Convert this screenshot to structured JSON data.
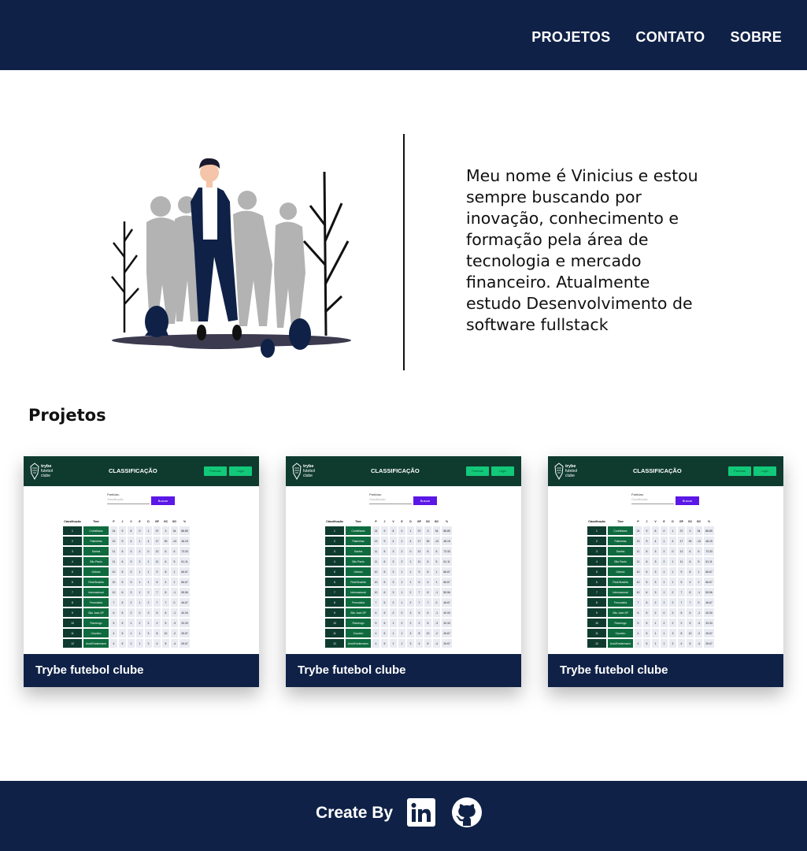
{
  "nav": {
    "items": [
      {
        "label": "PROJETOS"
      },
      {
        "label": "CONTATO"
      },
      {
        "label": "SOBRE"
      }
    ]
  },
  "about": {
    "text": "Meu nome é Vinicius e estou sempre buscando por inovação, conhecimento e formação pela área de tecnologia e mercado financeiro. Atualmente estudo Desenvolvimento de software fullstack"
  },
  "projects": {
    "title": "Projetos",
    "cards": [
      {
        "caption": "Trybe futebol clube"
      },
      {
        "caption": "Trybe futebol clube"
      },
      {
        "caption": "Trybe futebol clube"
      }
    ],
    "preview": {
      "brand": [
        "trybe",
        "futebol",
        "clube"
      ],
      "title": "CLASSIFICAÇÃO",
      "btn_partidas": "Partidas",
      "btn_login": "Login",
      "filter_label": "Partidas:",
      "filter_placeholder": "Classificação",
      "search_label": "Buscar",
      "headers": [
        "Classificação",
        "Time",
        "P",
        "J",
        "V",
        "E",
        "D",
        "GP",
        "GC",
        "SG",
        "%"
      ],
      "rows": [
        [
          "1",
          "Corinthians",
          "24",
          "9",
          "8",
          "0",
          "1",
          "37",
          "3",
          "34",
          "88.89"
        ],
        [
          "2",
          "Palmeiras",
          "13",
          "9",
          "4",
          "1",
          "4",
          "17",
          "30",
          "-13",
          "48.15"
        ],
        [
          "3",
          "Santos",
          "11",
          "5",
          "3",
          "2",
          "0",
          "12",
          "6",
          "6",
          "73.33"
        ],
        [
          "4",
          "São Paulo",
          "11",
          "6",
          "3",
          "2",
          "1",
          "11",
          "6",
          "5",
          "61.11"
        ],
        [
          "5",
          "Grêmio",
          "10",
          "5",
          "3",
          "1",
          "1",
          "9",
          "8",
          "1",
          "66.67"
        ],
        [
          "6",
          "Real Brasília",
          "10",
          "5",
          "3",
          "1",
          "1",
          "5",
          "4",
          "1",
          "66.67"
        ],
        [
          "7",
          "Internacional",
          "10",
          "6",
          "3",
          "1",
          "2",
          "7",
          "8",
          "-1",
          "55.56"
        ],
        [
          "8",
          "Ferroviária",
          "7",
          "5",
          "2",
          "1",
          "2",
          "7",
          "7",
          "0",
          "46.67"
        ],
        [
          "9",
          "São José-SP",
          "6",
          "5",
          "2",
          "0",
          "3",
          "5",
          "6",
          "-1",
          "40.00"
        ],
        [
          "10",
          "Flamengo",
          "5",
          "5",
          "1",
          "2",
          "2",
          "2",
          "5",
          "-3",
          "33.33"
        ],
        [
          "11",
          "Cruzeiro",
          "4",
          "5",
          "1",
          "1",
          "3",
          "8",
          "10",
          "-2",
          "26.67"
        ],
        [
          "12",
          "Avaí/Kindermann",
          "4",
          "5",
          "1",
          "1",
          "3",
          "4",
          "8",
          "-4",
          "26.67"
        ]
      ]
    }
  },
  "footer": {
    "label": "Create By"
  },
  "colors": {
    "navy": "#0f2147",
    "preview_header": "#0f3b2f",
    "preview_green": "#12c97a",
    "preview_purple": "#5b17e6"
  }
}
